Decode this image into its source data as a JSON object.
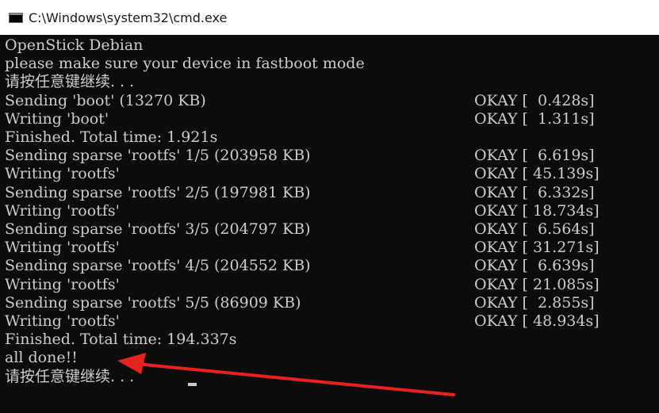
{
  "window": {
    "title": "C:\\Windows\\system32\\cmd.exe",
    "icon": "cmd-icon"
  },
  "console": {
    "lines": [
      {
        "text": "OpenStick Debian",
        "status": ""
      },
      {
        "text": "please make sure your device in fastboot mode",
        "status": ""
      },
      {
        "text": "请按任意键继续. . .",
        "status": ""
      },
      {
        "text": "Sending 'boot' (13270 KB)",
        "status": "OKAY [  0.428s]"
      },
      {
        "text": "Writing 'boot'",
        "status": "OKAY [  1.311s]"
      },
      {
        "text": "Finished. Total time: 1.921s",
        "status": ""
      },
      {
        "text": "Sending sparse 'rootfs' 1/5 (203958 KB)",
        "status": "OKAY [  6.619s]"
      },
      {
        "text": "Writing 'rootfs'",
        "status": "OKAY [ 45.139s]"
      },
      {
        "text": "Sending sparse 'rootfs' 2/5 (197981 KB)",
        "status": "OKAY [  6.332s]"
      },
      {
        "text": "Writing 'rootfs'",
        "status": "OKAY [ 18.734s]"
      },
      {
        "text": "Sending sparse 'rootfs' 3/5 (204797 KB)",
        "status": "OKAY [  6.564s]"
      },
      {
        "text": "Writing 'rootfs'",
        "status": "OKAY [ 31.271s]"
      },
      {
        "text": "Sending sparse 'rootfs' 4/5 (204552 KB)",
        "status": "OKAY [  6.639s]"
      },
      {
        "text": "Writing 'rootfs'",
        "status": "OKAY [ 21.085s]"
      },
      {
        "text": "Sending sparse 'rootfs' 5/5 (86909 KB)",
        "status": "OKAY [  2.855s]"
      },
      {
        "text": "Writing 'rootfs'",
        "status": "OKAY [ 48.934s]"
      },
      {
        "text": "Finished. Total time: 194.337s",
        "status": ""
      },
      {
        "text": "all done!!",
        "status": ""
      },
      {
        "text": "请按任意键继续. . .",
        "status": ""
      }
    ]
  },
  "colors": {
    "console_background": "#0c0c0c",
    "console_text": "#cccccc",
    "annotation_arrow": "#e8231f"
  }
}
